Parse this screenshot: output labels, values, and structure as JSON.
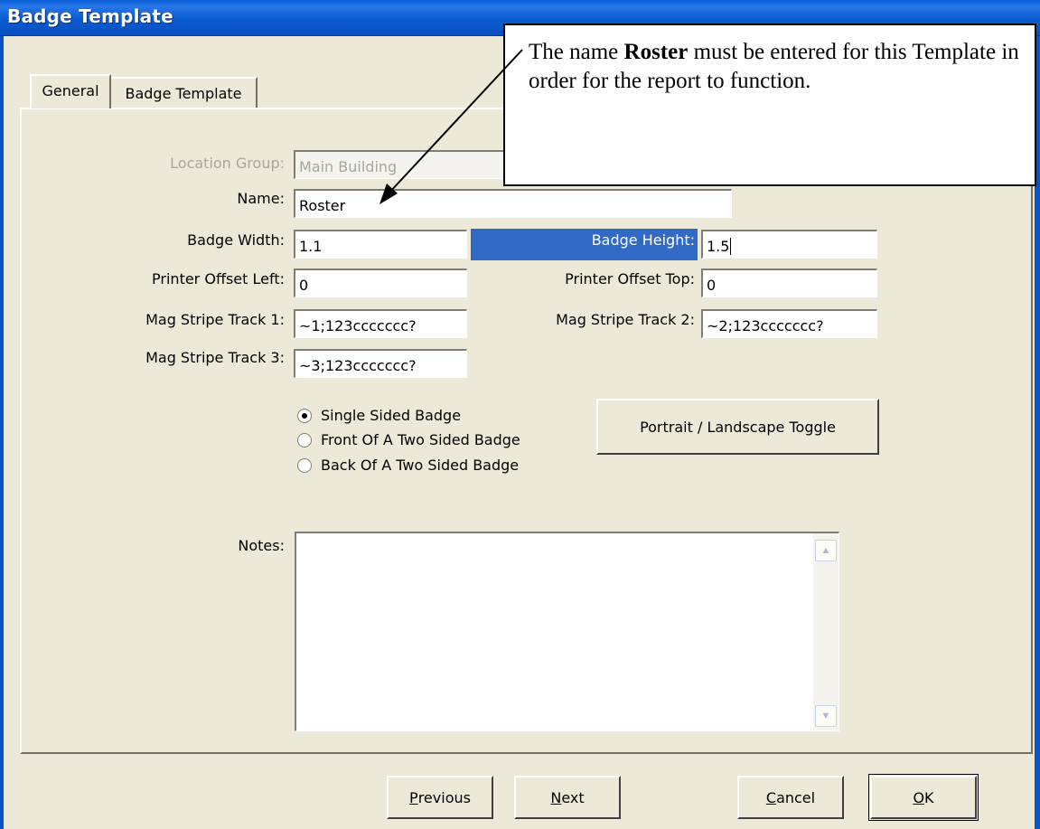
{
  "window": {
    "title": "Badge Template"
  },
  "tabs": [
    {
      "label": "General",
      "active": true
    },
    {
      "label": "Badge Template",
      "active": false
    }
  ],
  "form": {
    "location_group": {
      "label": "Location Group:",
      "value": "Main Building"
    },
    "name": {
      "label": "Name:",
      "value": "Roster"
    },
    "badge_width": {
      "label": "Badge Width:",
      "value": "1.1"
    },
    "badge_height": {
      "label": "Badge Height:",
      "value": "1.5"
    },
    "printer_offset_left": {
      "label": "Printer Offset Left:",
      "value": "0"
    },
    "printer_offset_top": {
      "label": "Printer Offset Top:",
      "value": "0"
    },
    "mag_track_1": {
      "label": "Mag Stripe Track 1:",
      "value": "~1;123ccccccc?"
    },
    "mag_track_2": {
      "label": "Mag Stripe Track 2:",
      "value": "~2;123ccccccc?"
    },
    "mag_track_3": {
      "label": "Mag Stripe Track 3:",
      "value": "~3;123ccccccc?"
    },
    "sides": {
      "options": [
        {
          "label": "Single Sided Badge",
          "selected": true
        },
        {
          "label": "Front Of A Two Sided Badge",
          "selected": false
        },
        {
          "label": "Back Of A Two Sided Badge",
          "selected": false
        }
      ]
    },
    "orientation_button": "Portrait / Landscape Toggle",
    "notes": {
      "label": "Notes:",
      "value": ""
    }
  },
  "buttons": {
    "previous": {
      "mnemonic": "P",
      "rest": "revious"
    },
    "next": {
      "mnemonic": "N",
      "rest": "ext"
    },
    "cancel": {
      "mnemonic": "C",
      "rest": "ancel"
    },
    "ok": {
      "mnemonic": "O",
      "rest": "K"
    }
  },
  "callout": {
    "text_before": "The name ",
    "text_bold": "Roster",
    "text_after": " must be entered for this Template in order for the report to function."
  },
  "colors": {
    "titlebar": "#0a5bd0",
    "dialog_bg": "#ece9d8",
    "selection": "#316ac5"
  }
}
